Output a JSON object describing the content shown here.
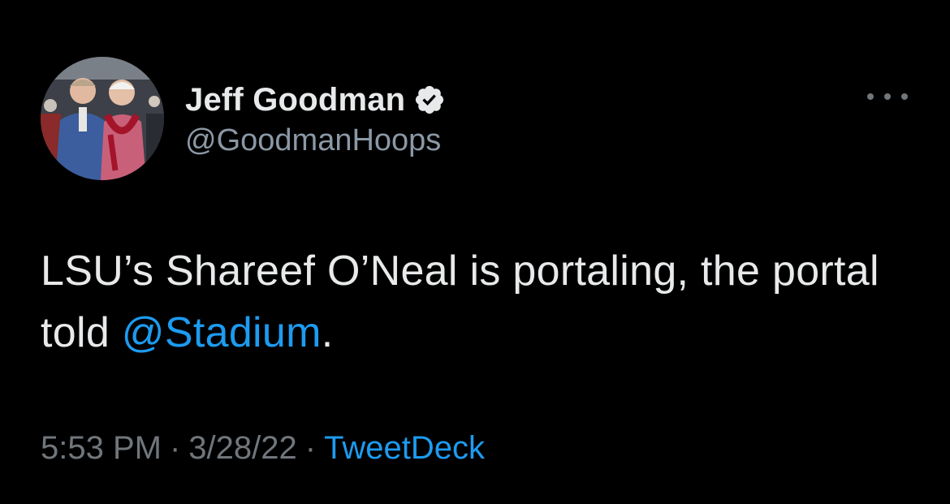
{
  "tweet": {
    "author": {
      "display_name": "Jeff Goodman",
      "handle": "@GoodmanHoops",
      "verified_icon": "verified-badge-icon",
      "avatar_icon": "profile-photo"
    },
    "more_icon": "more-options-icon",
    "text": {
      "part1": "LSU’s Shareef O’Neal is portaling, the portal told ",
      "mention": "@Stadium",
      "part2": "."
    },
    "meta": {
      "time": "5:53 PM",
      "separator1": "·",
      "date": "3/28/22",
      "separator2": "·",
      "source": "TweetDeck"
    }
  },
  "colors": {
    "background": "#000000",
    "primary_text": "#e7e9ea",
    "secondary_text": "#8b98a5",
    "link": "#1d9bf0"
  }
}
